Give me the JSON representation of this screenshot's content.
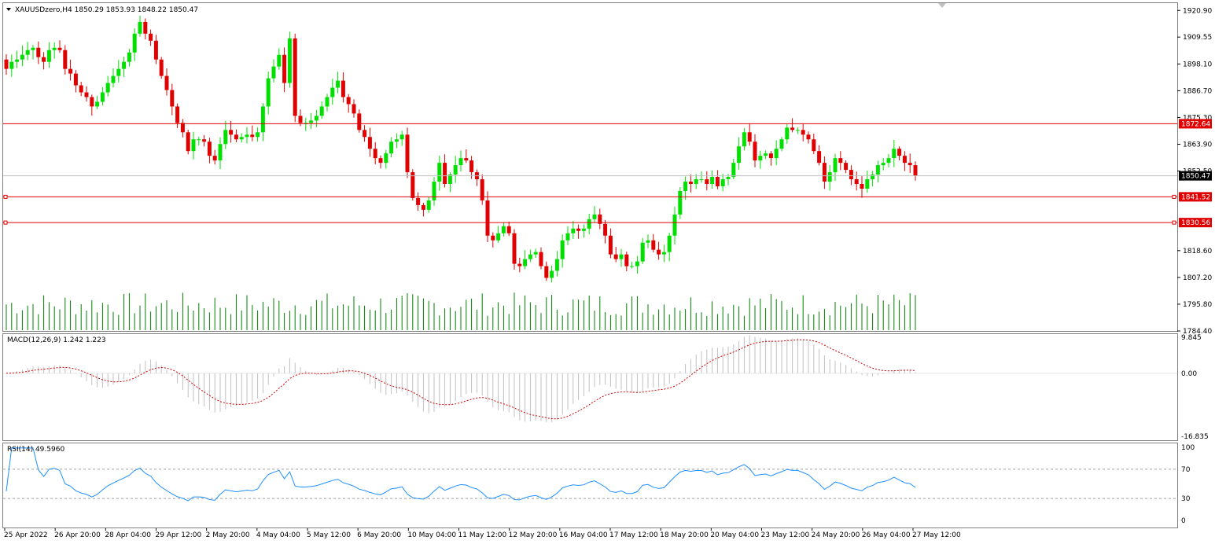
{
  "header": {
    "symbol_line": "XAUUSDzero,H4  1850.29 1853.93 1848.22 1850.47",
    "macd_label": "MACD(12,26,9) 1.242 1.223",
    "rsi_label": "RSI(14) 49.5960"
  },
  "price_axis": {
    "ticks": [
      "1920.90",
      "1909.55",
      "1898.10",
      "1886.70",
      "1875.30",
      "1863.90",
      "1852.50",
      "1818.60",
      "1807.20",
      "1795.80",
      "1784.40"
    ]
  },
  "level_labels": {
    "current": "1850.47",
    "r1": "1872.64",
    "s1": "1841.52",
    "s2": "1830.56"
  },
  "macd_axis": {
    "ticks": [
      "9.845",
      "0.00",
      "-16.835"
    ]
  },
  "rsi_axis": {
    "ticks": [
      "100",
      "70",
      "30",
      "0"
    ]
  },
  "time_axis": {
    "labels": [
      "25 Apr 2022",
      "26 Apr 20:00",
      "28 Apr 04:00",
      "29 Apr 12:00",
      "2 May 20:00",
      "4 May 04:00",
      "5 May 12:00",
      "6 May 20:00",
      "10 May 04:00",
      "11 May 12:00",
      "12 May 20:00",
      "16 May 04:00",
      "17 May 12:00",
      "18 May 20:00",
      "20 May 04:00",
      "23 May 12:00",
      "24 May 20:00",
      "26 May 04:00",
      "27 May 12:00"
    ]
  },
  "colors": {
    "bull": "#00e000",
    "bear": "#e00000",
    "volume": "#008000",
    "level_line": "#e00000",
    "macd_hist": "#c0c0c0",
    "macd_signal": "#d00000",
    "rsi_line": "#1e90ff",
    "current_price_bg": "#000000"
  },
  "chart_data": {
    "type": "candlestick",
    "timeframe": "H4",
    "price_range": [
      1784.4,
      1924.0
    ],
    "horizontal_levels": [
      1872.64,
      1841.52,
      1830.56
    ],
    "current_price": 1850.47,
    "close": [
      1896,
      1899,
      1900,
      1902,
      1904,
      1905,
      1901,
      1899,
      1904,
      1905,
      1904,
      1896,
      1894,
      1889,
      1886,
      1884,
      1880,
      1882,
      1886,
      1890,
      1893,
      1896,
      1899,
      1903,
      1911,
      1916,
      1911,
      1908,
      1900,
      1893,
      1887,
      1880,
      1873,
      1869,
      1861,
      1866,
      1866,
      1865,
      1859,
      1857,
      1864,
      1870,
      1868,
      1866,
      1867,
      1868,
      1867,
      1869,
      1880,
      1892,
      1897,
      1902,
      1890,
      1909,
      1876,
      1873,
      1873,
      1874,
      1876,
      1880,
      1884,
      1888,
      1891,
      1884,
      1881,
      1877,
      1870,
      1867,
      1862,
      1858,
      1856,
      1860,
      1865,
      1866,
      1868,
      1852,
      1841,
      1838,
      1836,
      1840,
      1848,
      1856,
      1847,
      1851,
      1855,
      1858,
      1857,
      1852,
      1849,
      1840,
      1825,
      1823,
      1826,
      1829,
      1826,
      1813,
      1812,
      1815,
      1817,
      1818,
      1812,
      1807,
      1810,
      1815,
      1823,
      1826,
      1828,
      1827,
      1828,
      1832,
      1834,
      1830,
      1825,
      1817,
      1815,
      1817,
      1812,
      1812,
      1814,
      1822,
      1823,
      1819,
      1817,
      1818,
      1825,
      1834,
      1844,
      1848,
      1847,
      1849,
      1849,
      1847,
      1850,
      1846,
      1849,
      1850,
      1856,
      1863,
      1869,
      1865,
      1857,
      1859,
      1860,
      1858,
      1862,
      1866,
      1871,
      1870,
      1870,
      1868,
      1866,
      1861,
      1856,
      1848,
      1852,
      1858,
      1856,
      1853,
      1849,
      1847,
      1845,
      1849,
      1851,
      1855,
      1856,
      1858,
      1862,
      1859,
      1856,
      1855,
      1850.47
    ]
  }
}
